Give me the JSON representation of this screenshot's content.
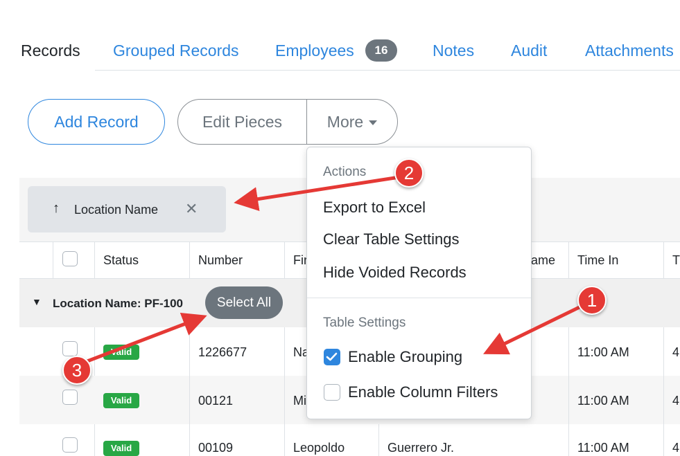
{
  "tabs": [
    {
      "label": "Records",
      "active": true
    },
    {
      "label": "Grouped Records",
      "active": false
    },
    {
      "label": "Employees",
      "active": false,
      "count": "16"
    },
    {
      "label": "Notes",
      "active": false
    },
    {
      "label": "Audit",
      "active": false
    },
    {
      "label": "Attachments",
      "active": false
    }
  ],
  "toolbar": {
    "add_label": "Add Record",
    "edit_label": "Edit Pieces",
    "more_label": "More"
  },
  "grouping": {
    "chip_label": "Location Name",
    "sort_icon": "up-arrow-icon",
    "close_icon": "close-icon"
  },
  "table": {
    "columns": [
      "Status",
      "Number",
      "Fir",
      "ame",
      "Time In",
      "T"
    ],
    "group": {
      "label": "Location Name: PF-100",
      "select_all": "Select All"
    },
    "rows": [
      {
        "status": "Valid",
        "number": "1226677",
        "first": "Na",
        "last": "",
        "time_in": "11:00 AM",
        "extra": "4"
      },
      {
        "status": "Valid",
        "number": "00121",
        "first": "Mi",
        "last": "",
        "time_in": "11:00 AM",
        "extra": "4"
      },
      {
        "status": "Valid",
        "number": "00109",
        "first": "Leopoldo",
        "last": "Guerrero Jr.",
        "time_in": "11:00 AM",
        "extra": "4"
      }
    ]
  },
  "menu": {
    "actions_header": "Actions",
    "items": [
      "Export to Excel",
      "Clear Table Settings",
      "Hide Voided Records"
    ],
    "settings_header": "Table Settings",
    "toggles": [
      {
        "label": "Enable Grouping",
        "checked": true
      },
      {
        "label": "Enable Column Filters",
        "checked": false
      }
    ]
  },
  "annotations": [
    "1",
    "2",
    "3"
  ],
  "colors": {
    "accent": "#2e86de",
    "badge": "#6c757d",
    "valid": "#28a745",
    "annotation": "#e53935"
  }
}
